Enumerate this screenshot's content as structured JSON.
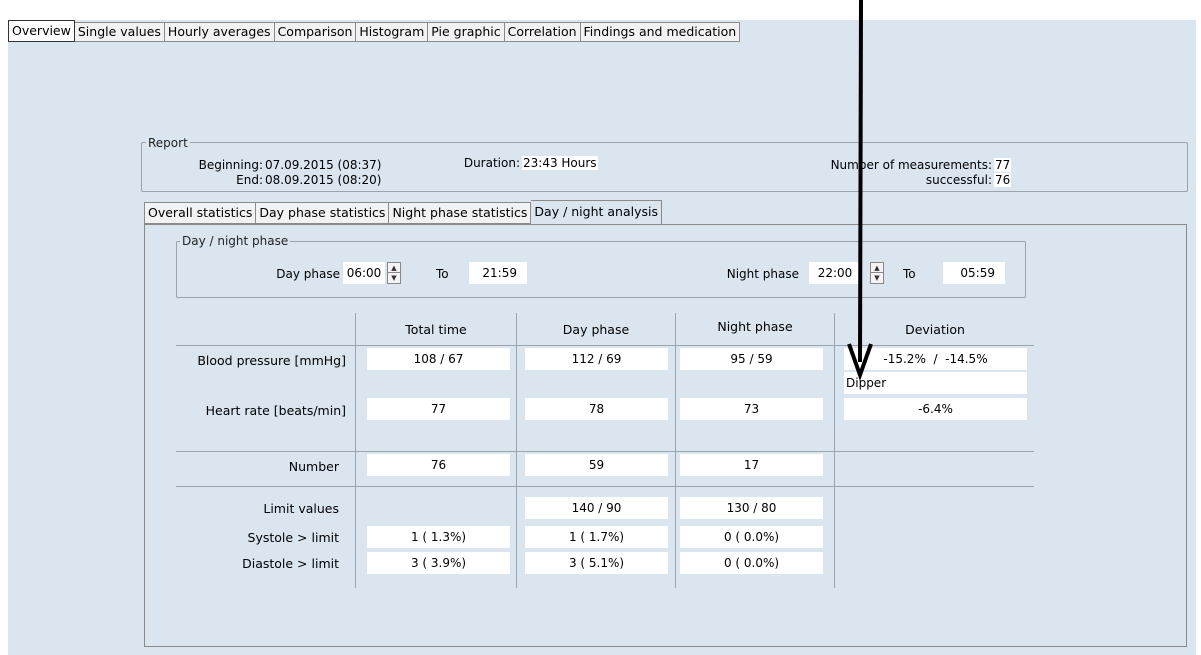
{
  "top_tabs": [
    "Overview",
    "Single values",
    "Hourly averages",
    "Comparison",
    "Histogram",
    "Pie graphic",
    "Correlation",
    "Findings and medication"
  ],
  "report": {
    "legend": "Report",
    "beginning_label": "Beginning:",
    "beginning_value": "07.09.2015  (08:37)",
    "end_label": "End:",
    "end_value": "08.09.2015  (08:20)",
    "duration_label": "Duration:",
    "duration_value": "23:43 Hours",
    "measurements_label": "Number of measurements:",
    "measurements_value": "77",
    "successful_label": "successful:",
    "successful_value": "76"
  },
  "sub_tabs": [
    "Overall statistics",
    "Day phase statistics",
    "Night phase statistics",
    "Day / night analysis"
  ],
  "phase": {
    "legend": "Day / night phase",
    "day_label": "Day phase",
    "day_start": "06:00",
    "to1": "To",
    "day_end": "21:59",
    "night_label": "Night phase",
    "night_start": "22:00",
    "to2": "To",
    "night_end": "05:59"
  },
  "table": {
    "headers": [
      "Total time",
      "Day phase",
      "Night phase",
      "Deviation"
    ],
    "bp_label": "Blood pressure [mmHg]",
    "bp": [
      "108 / 67",
      "112 / 69",
      "95 / 59"
    ],
    "bp_deviation": "-15.2%  /  -14.5%",
    "dipper": "Dipper",
    "hr_label": "Heart rate [beats/min]",
    "hr": [
      "77",
      "78",
      "73"
    ],
    "hr_deviation": "-6.4%",
    "number_label": "Number",
    "number": [
      "76",
      "59",
      "17"
    ],
    "limit_label": "Limit values",
    "limit": [
      "140 / 90",
      "130 / 80"
    ],
    "systole_label": "Systole > limit",
    "systole": [
      "1 ( 1.3%)",
      "1 ( 1.7%)",
      "0 ( 0.0%)"
    ],
    "diastole_label": "Diastole > limit",
    "diastole": [
      "3 ( 3.9%)",
      "3 ( 5.1%)",
      "0 ( 0.0%)"
    ]
  },
  "colors": {
    "background": "#dbe5f0",
    "field": "#ffffff",
    "border": "#9aa4ad"
  }
}
